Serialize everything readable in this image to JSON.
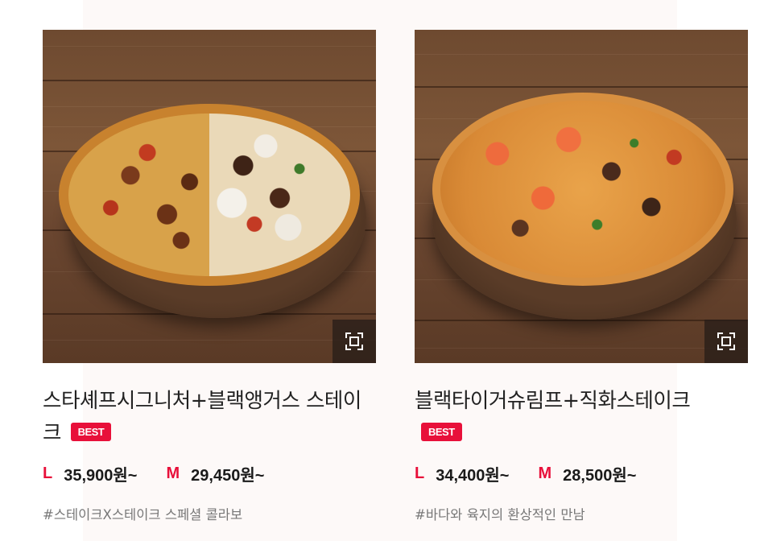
{
  "products": [
    {
      "title": "스타셰프시그니처+블랙앵거스 스테이크",
      "badge": "BEST",
      "price_large_label": "L",
      "price_large": "35,900원~",
      "price_medium_label": "M",
      "price_medium": "29,450원~",
      "tag": "#스테이크X스테이크 스페셜 콜라보",
      "zoom_icon": "expand-icon"
    },
    {
      "title": "블랙타이거슈림프+직화스테이크",
      "badge": "BEST",
      "price_large_label": "L",
      "price_large": "34,400원~",
      "price_medium_label": "M",
      "price_medium": "28,500원~",
      "tag": "#바다와 육지의 환상적인 만남",
      "zoom_icon": "expand-icon"
    }
  ],
  "colors": {
    "accent": "#e8103a",
    "text": "#222222",
    "muted": "#777777",
    "zoom_bg": "#28201a"
  }
}
